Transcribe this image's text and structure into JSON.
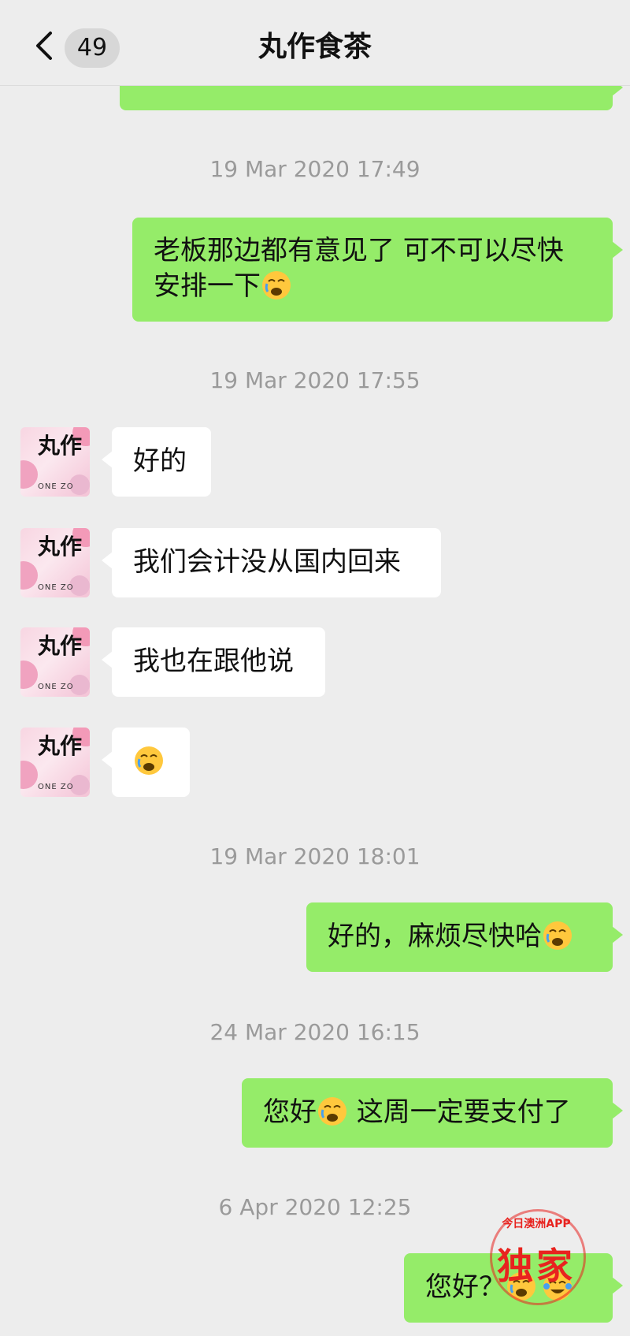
{
  "header": {
    "unread_count": "49",
    "title": "丸作食茶"
  },
  "avatar": {
    "brand_mark": "丸作",
    "brand_text": "ONE ZO"
  },
  "messages": [
    {
      "type": "timestamp",
      "text": "19 Mar 2020 17:49"
    },
    {
      "type": "out",
      "line1": "老板那边都有意见了 可不可以尽快",
      "line2": "安排一下"
    },
    {
      "type": "timestamp",
      "text": "19 Mar 2020 17:55"
    },
    {
      "type": "in",
      "text": "好的"
    },
    {
      "type": "in",
      "text": "我们会计没从国内回来"
    },
    {
      "type": "in",
      "text": "我也在跟他说"
    },
    {
      "type": "in",
      "emoji": "weary-emoji"
    },
    {
      "type": "timestamp",
      "text": "19 Mar 2020 18:01"
    },
    {
      "type": "out",
      "text": "好的，麻烦尽快哈"
    },
    {
      "type": "timestamp",
      "text": "24 Mar 2020 16:15"
    },
    {
      "type": "out",
      "text_before": "您好",
      "text_after": " 这周一定要支付了"
    },
    {
      "type": "timestamp",
      "text": "6 Apr 2020 12:25"
    },
    {
      "type": "out",
      "text": "您好？"
    }
  ],
  "watermark": {
    "top_text": "今日澳洲APP",
    "main_text": "独家"
  },
  "colors": {
    "background": "#ededed",
    "outgoing_bubble": "#95ec69",
    "incoming_bubble": "#ffffff",
    "timestamp": "#9a9a9a",
    "watermark": "#e8231f"
  }
}
